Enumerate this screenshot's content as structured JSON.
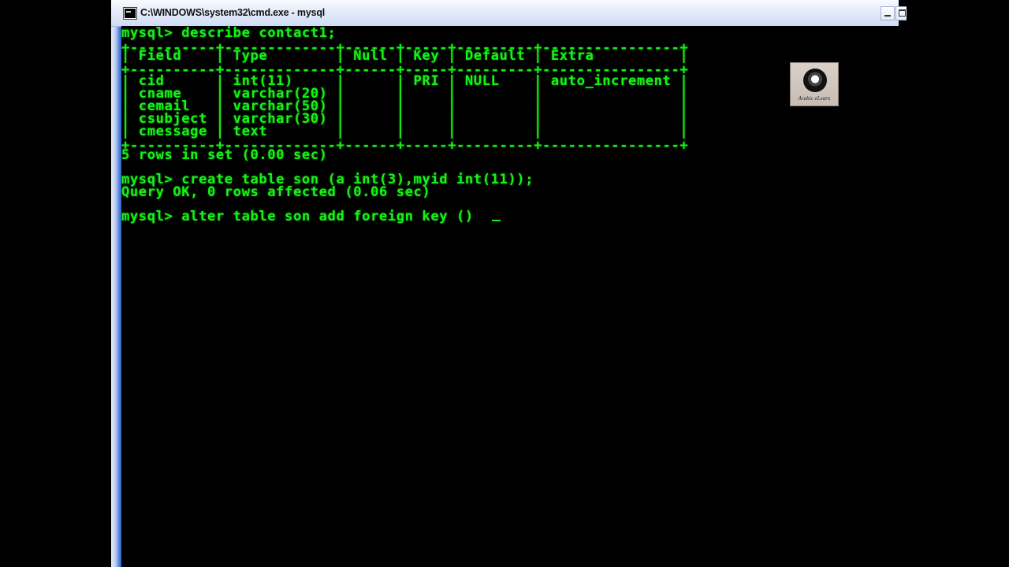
{
  "window": {
    "title": "C:\\WINDOWS\\system32\\cmd.exe - mysql",
    "icon": "console-icon"
  },
  "console": {
    "lines": [
      "mysql> describe contact1;",
      "+----------+-------------+------+-----+---------+----------------+",
      "| Field    | Type        | Null | Key | Default | Extra          |",
      "+----------+-------------+------+-----+---------+----------------+",
      "| cid      | int(11)     |      | PRI | NULL    | auto_increment |",
      "| cname    | varchar(20) |      |     |         |                |",
      "| cemail   | varchar(50) |      |     |         |                |",
      "| csubject | varchar(30) |      |     |         |                |",
      "| cmessage | text        |      |     |         |                |",
      "+----------+-------------+------+-----+---------+----------------+",
      "5 rows in set (0.00 sec)",
      "",
      "mysql> create table son (a int(3),myid int(11));",
      "Query OK, 0 rows affected (0.06 sec)",
      "",
      "mysql> alter table son add foreign key ()"
    ]
  },
  "watermark": {
    "caption": "Arabic eLearn"
  },
  "colors": {
    "console_text": "#16f216",
    "console_bg": "#000000"
  }
}
